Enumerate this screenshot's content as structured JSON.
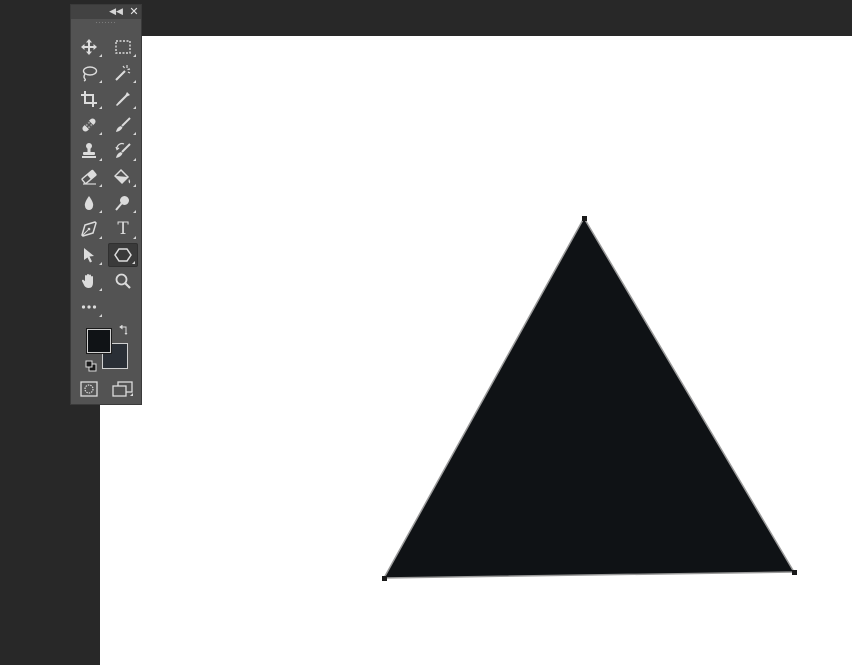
{
  "app": {
    "workspace_color": "#282828",
    "canvas_color": "#ffffff",
    "toolbar_color": "#535353"
  },
  "toolbar": {
    "header_icons": [
      "collapse-icon",
      "close-icon"
    ],
    "tools": [
      {
        "name": "move-tool",
        "icon": "move-icon",
        "active": false
      },
      {
        "name": "rectangular-marquee-tool",
        "icon": "marquee-icon",
        "active": false
      },
      {
        "name": "lasso-tool",
        "icon": "lasso-icon",
        "active": false
      },
      {
        "name": "magic-wand-tool",
        "icon": "magic-wand-icon",
        "active": false
      },
      {
        "name": "crop-tool",
        "icon": "crop-icon",
        "active": false
      },
      {
        "name": "eyedropper-tool",
        "icon": "eyedropper-icon",
        "active": false
      },
      {
        "name": "healing-brush-tool",
        "icon": "bandage-icon",
        "active": false
      },
      {
        "name": "brush-tool",
        "icon": "brush-icon",
        "active": false
      },
      {
        "name": "clone-stamp-tool",
        "icon": "stamp-icon",
        "active": false
      },
      {
        "name": "history-brush-tool",
        "icon": "history-brush-icon",
        "active": false
      },
      {
        "name": "eraser-tool",
        "icon": "eraser-icon",
        "active": false
      },
      {
        "name": "paint-bucket-tool",
        "icon": "paint-bucket-icon",
        "active": false
      },
      {
        "name": "blur-tool",
        "icon": "drop-icon",
        "active": false
      },
      {
        "name": "dodge-tool",
        "icon": "dodge-icon",
        "active": false
      },
      {
        "name": "pen-tool",
        "icon": "pen-icon",
        "active": false
      },
      {
        "name": "type-tool",
        "icon": "type-icon",
        "type_glyph": "T",
        "active": false
      },
      {
        "name": "path-selection-tool",
        "icon": "arrow-cursor-icon",
        "active": false
      },
      {
        "name": "polygon-tool",
        "icon": "hexagon-icon",
        "active": true
      },
      {
        "name": "hand-tool",
        "icon": "hand-icon",
        "active": false
      },
      {
        "name": "zoom-tool",
        "icon": "magnifier-icon",
        "active": false
      },
      {
        "name": "edit-toolbar",
        "icon": "more-dots-icon",
        "active": false
      }
    ],
    "foreground_color": "#101316",
    "background_color": "#2a2f36"
  },
  "canvas": {
    "shape": {
      "type": "triangle",
      "fill": "#0f1215",
      "stroke": "#9a9a9a"
    }
  }
}
